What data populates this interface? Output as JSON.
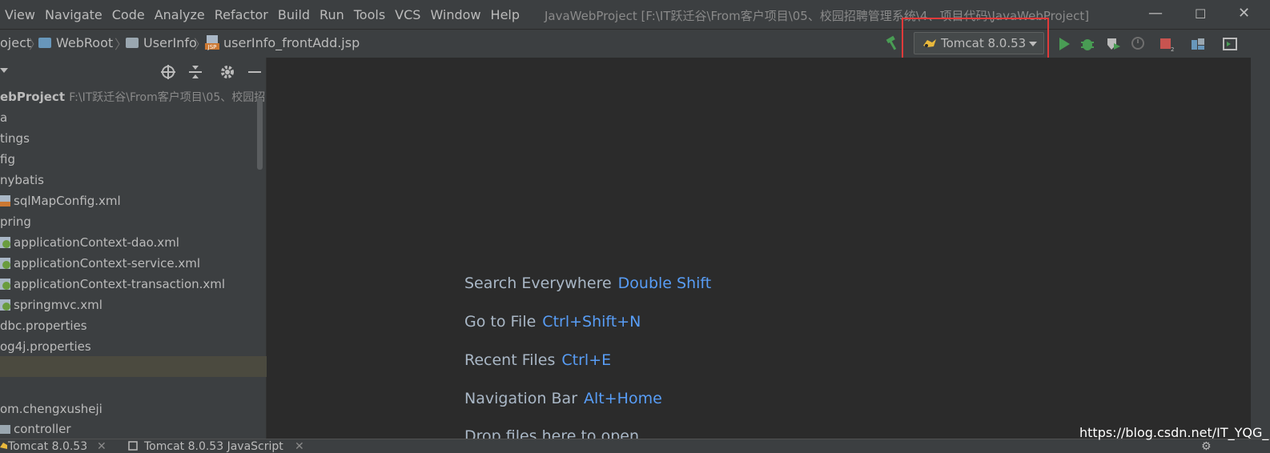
{
  "menubar": {
    "items": [
      "View",
      "Navigate",
      "Code",
      "Analyze",
      "Refactor",
      "Build",
      "Run",
      "Tools",
      "VCS",
      "Window",
      "Help"
    ],
    "window_title": "JavaWebProject [F:\\IT跃迁谷\\From客户项目\\05、校园招聘管理系统\\4、项目代码\\JavaWebProject]"
  },
  "navbar": {
    "crumbs": [
      "oject",
      "WebRoot",
      "UserInfo",
      "userInfo_frontAdd.jsp"
    ],
    "run_config": "Tomcat 8.0.53"
  },
  "project_tree": {
    "root_name": "ebProject",
    "root_path": "F:\\IT跃迁谷\\From客户项目\\05、校园招",
    "rows": [
      {
        "label": "a",
        "icon": ""
      },
      {
        "label": "tings",
        "icon": ""
      },
      {
        "label": "fig",
        "icon": ""
      },
      {
        "label": "nybatis",
        "icon": ""
      },
      {
        "label": "sqlMapConfig.xml",
        "icon": "xml-file-icon"
      },
      {
        "label": "pring",
        "icon": ""
      },
      {
        "label": "applicationContext-dao.xml",
        "icon": "spring-xml-icon"
      },
      {
        "label": "applicationContext-service.xml",
        "icon": "spring-xml-icon"
      },
      {
        "label": "applicationContext-transaction.xml",
        "icon": "spring-xml-icon"
      },
      {
        "label": "springmvc.xml",
        "icon": "spring-xml-icon"
      },
      {
        "label": "dbc.properties",
        "icon": ""
      },
      {
        "label": "og4j.properties",
        "icon": ""
      },
      {
        "label": "",
        "icon": ""
      },
      {
        "label": "",
        "icon": ""
      },
      {
        "label": "om.chengxusheji",
        "icon": ""
      },
      {
        "label": "controller",
        "icon": "package-icon"
      }
    ]
  },
  "editor": {
    "hints": [
      {
        "action": "Search Everywhere",
        "shortcut": "Double Shift"
      },
      {
        "action": "Go to File",
        "shortcut": "Ctrl+Shift+N"
      },
      {
        "action": "Recent Files",
        "shortcut": "Ctrl+E"
      },
      {
        "action": "Navigation Bar",
        "shortcut": "Alt+Home"
      },
      {
        "action": "Drop files here to open",
        "shortcut": ""
      }
    ]
  },
  "bottombar": {
    "tabs": [
      "Tomcat 8.0.53",
      "Tomcat 8.0.53 JavaScript"
    ]
  },
  "watermark": "https://blog.csdn.net/IT_YQG_",
  "colors": {
    "accent_shortcut": "#589df6",
    "highlight_box": "#e03a3a",
    "run_green": "#499c54",
    "stop_red": "#c75450"
  }
}
